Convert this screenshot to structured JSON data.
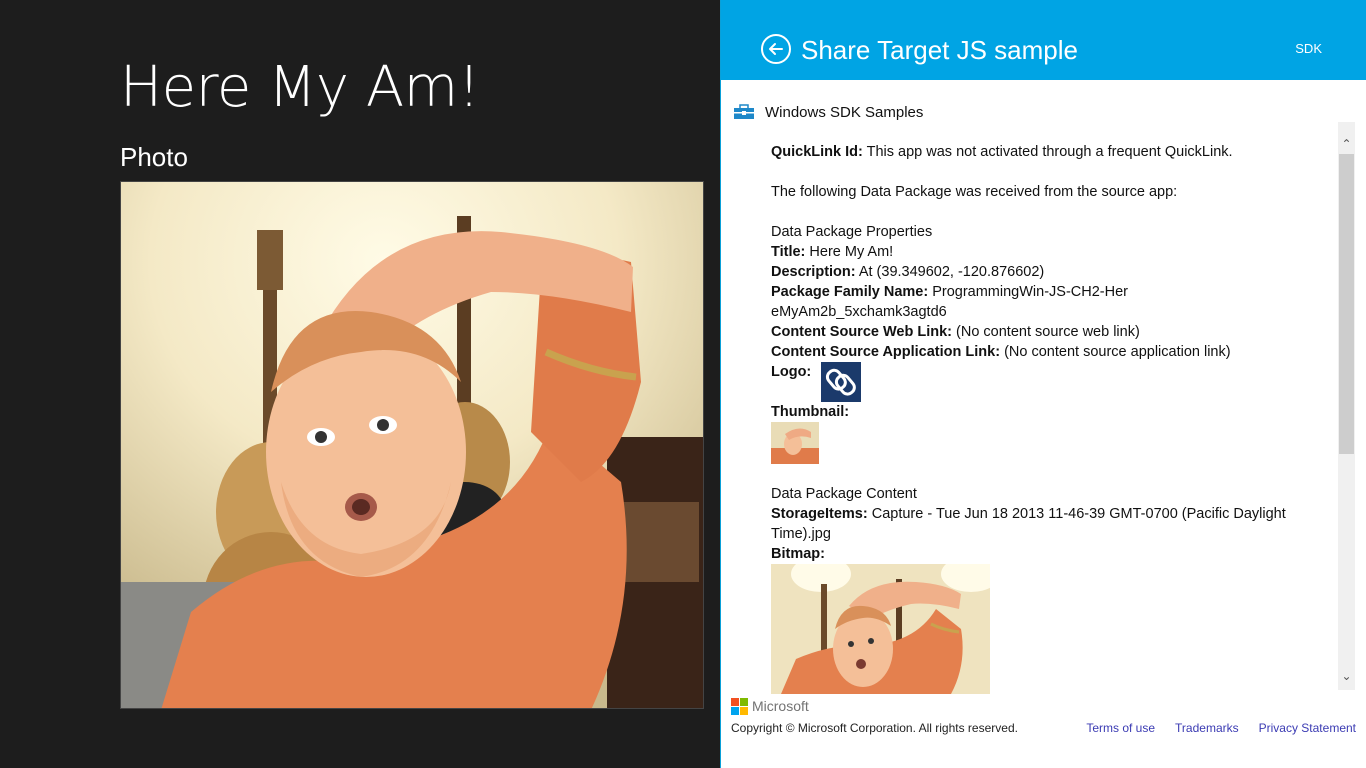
{
  "left_app": {
    "title": "Here My Am!",
    "section_label": "Photo"
  },
  "share_pane": {
    "title": "Share Target JS sample",
    "sdk_label": "SDK",
    "samples_label": "Windows SDK Samples",
    "quicklink_label": "QuickLink Id:",
    "quicklink_value": " This app was not activated through a frequent QuickLink.",
    "received_text": "The following Data Package was received from the source app:",
    "properties_heading": "Data Package Properties",
    "title_label": "Title:",
    "title_value": " Here My Am!",
    "description_label": "Description:",
    "description_value": " At (39.349602, -120.876602)",
    "family_label": "Package Family Name:",
    "family_value": " ProgrammingWin-JS-CH2-HereMyAm2b_5xchamk3agtd6",
    "web_link_label": "Content Source Web Link:",
    "web_link_value": " (No content source web link)",
    "app_link_label": "Content Source Application Link:",
    "app_link_value": " (No content source application link)",
    "logo_label": "Logo:",
    "thumbnail_label": "Thumbnail:",
    "content_heading": "Data Package Content",
    "storage_label": "StorageItems:",
    "storage_value": " Capture - Tue Jun 18 2013 11-46-39 GMT-0700 (Pacific Daylight Time).jpg",
    "bitmap_label": "Bitmap:"
  },
  "footer": {
    "brand": "Microsoft",
    "copyright": "Copyright © Microsoft Corporation. All rights reserved.",
    "links": [
      "Terms of use",
      "Trademarks",
      "Privacy Statement"
    ]
  },
  "colors": {
    "header_blue": "#00a4e4",
    "left_background": "#1d1d1d",
    "logo_tile": "#1b3a6b",
    "link": "#3b3bb3"
  },
  "icons": {
    "back": "back-arrow-circle-icon",
    "samples": "toolbox-icon",
    "logo": "chain-link-icon"
  }
}
